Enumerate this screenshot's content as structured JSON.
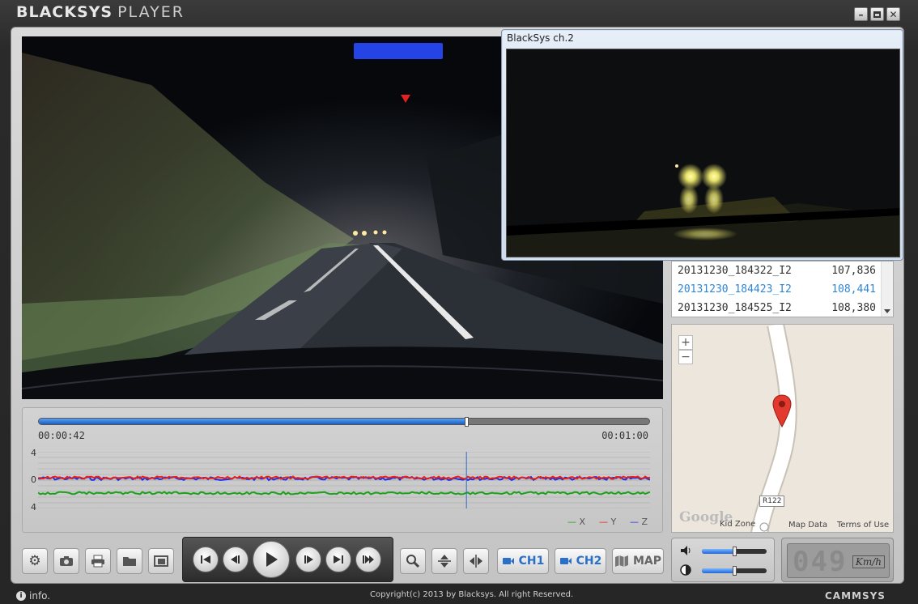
{
  "app": {
    "brand_bold": "BLACKSYS",
    "brand_light": "PLAYER",
    "window_controls": [
      "minimize-icon",
      "maximize-icon",
      "close-icon"
    ]
  },
  "popup": {
    "title": "BlackSys ch.2"
  },
  "playlist": {
    "items": [
      {
        "name": "20131230_184322_I2",
        "size": "107,836",
        "selected": false
      },
      {
        "name": "20131230_184423_I2",
        "size": "108,441",
        "selected": true
      },
      {
        "name": "20131230_184525_I2",
        "size": "108,380",
        "selected": false
      }
    ],
    "selected_color": "#2e86d6"
  },
  "map": {
    "zoom_in": "+",
    "zoom_out": "−",
    "road_label": "R122",
    "provider": "Google",
    "attribution_kid": "Kid Zone",
    "attribution_data": "Map Data",
    "attribution_terms": "Terms of Use"
  },
  "timeline": {
    "current_time": "00:00:42",
    "total_time": "00:01:00",
    "progress": 0.7,
    "y_labels": [
      "4",
      "0",
      "4"
    ],
    "legend": [
      "X",
      "Y",
      "Z"
    ],
    "legend_colors": [
      "#1aa31a",
      "#e52020",
      "#1f2fe0"
    ]
  },
  "controls": {
    "settings": "gear-icon",
    "snapshot": "camera-icon",
    "print": "printer-icon",
    "open": "folder-icon",
    "fullscreen": "window-icon",
    "zoom": "magnifier-icon",
    "flip_v": "flip-vertical-icon",
    "flip_h": "flip-horizontal-icon",
    "ch1_label": "CH1",
    "ch2_label": "CH2",
    "map_label": "MAP"
  },
  "volume": {
    "level": 0.5,
    "brightness": 0.5
  },
  "speed": {
    "value": "049",
    "unit": "Km/h"
  },
  "footer": {
    "info": "info.",
    "copyright": "Copyright(c) 2013 by Blacksys. All right Reserved.",
    "company": "CAMMSYS"
  }
}
